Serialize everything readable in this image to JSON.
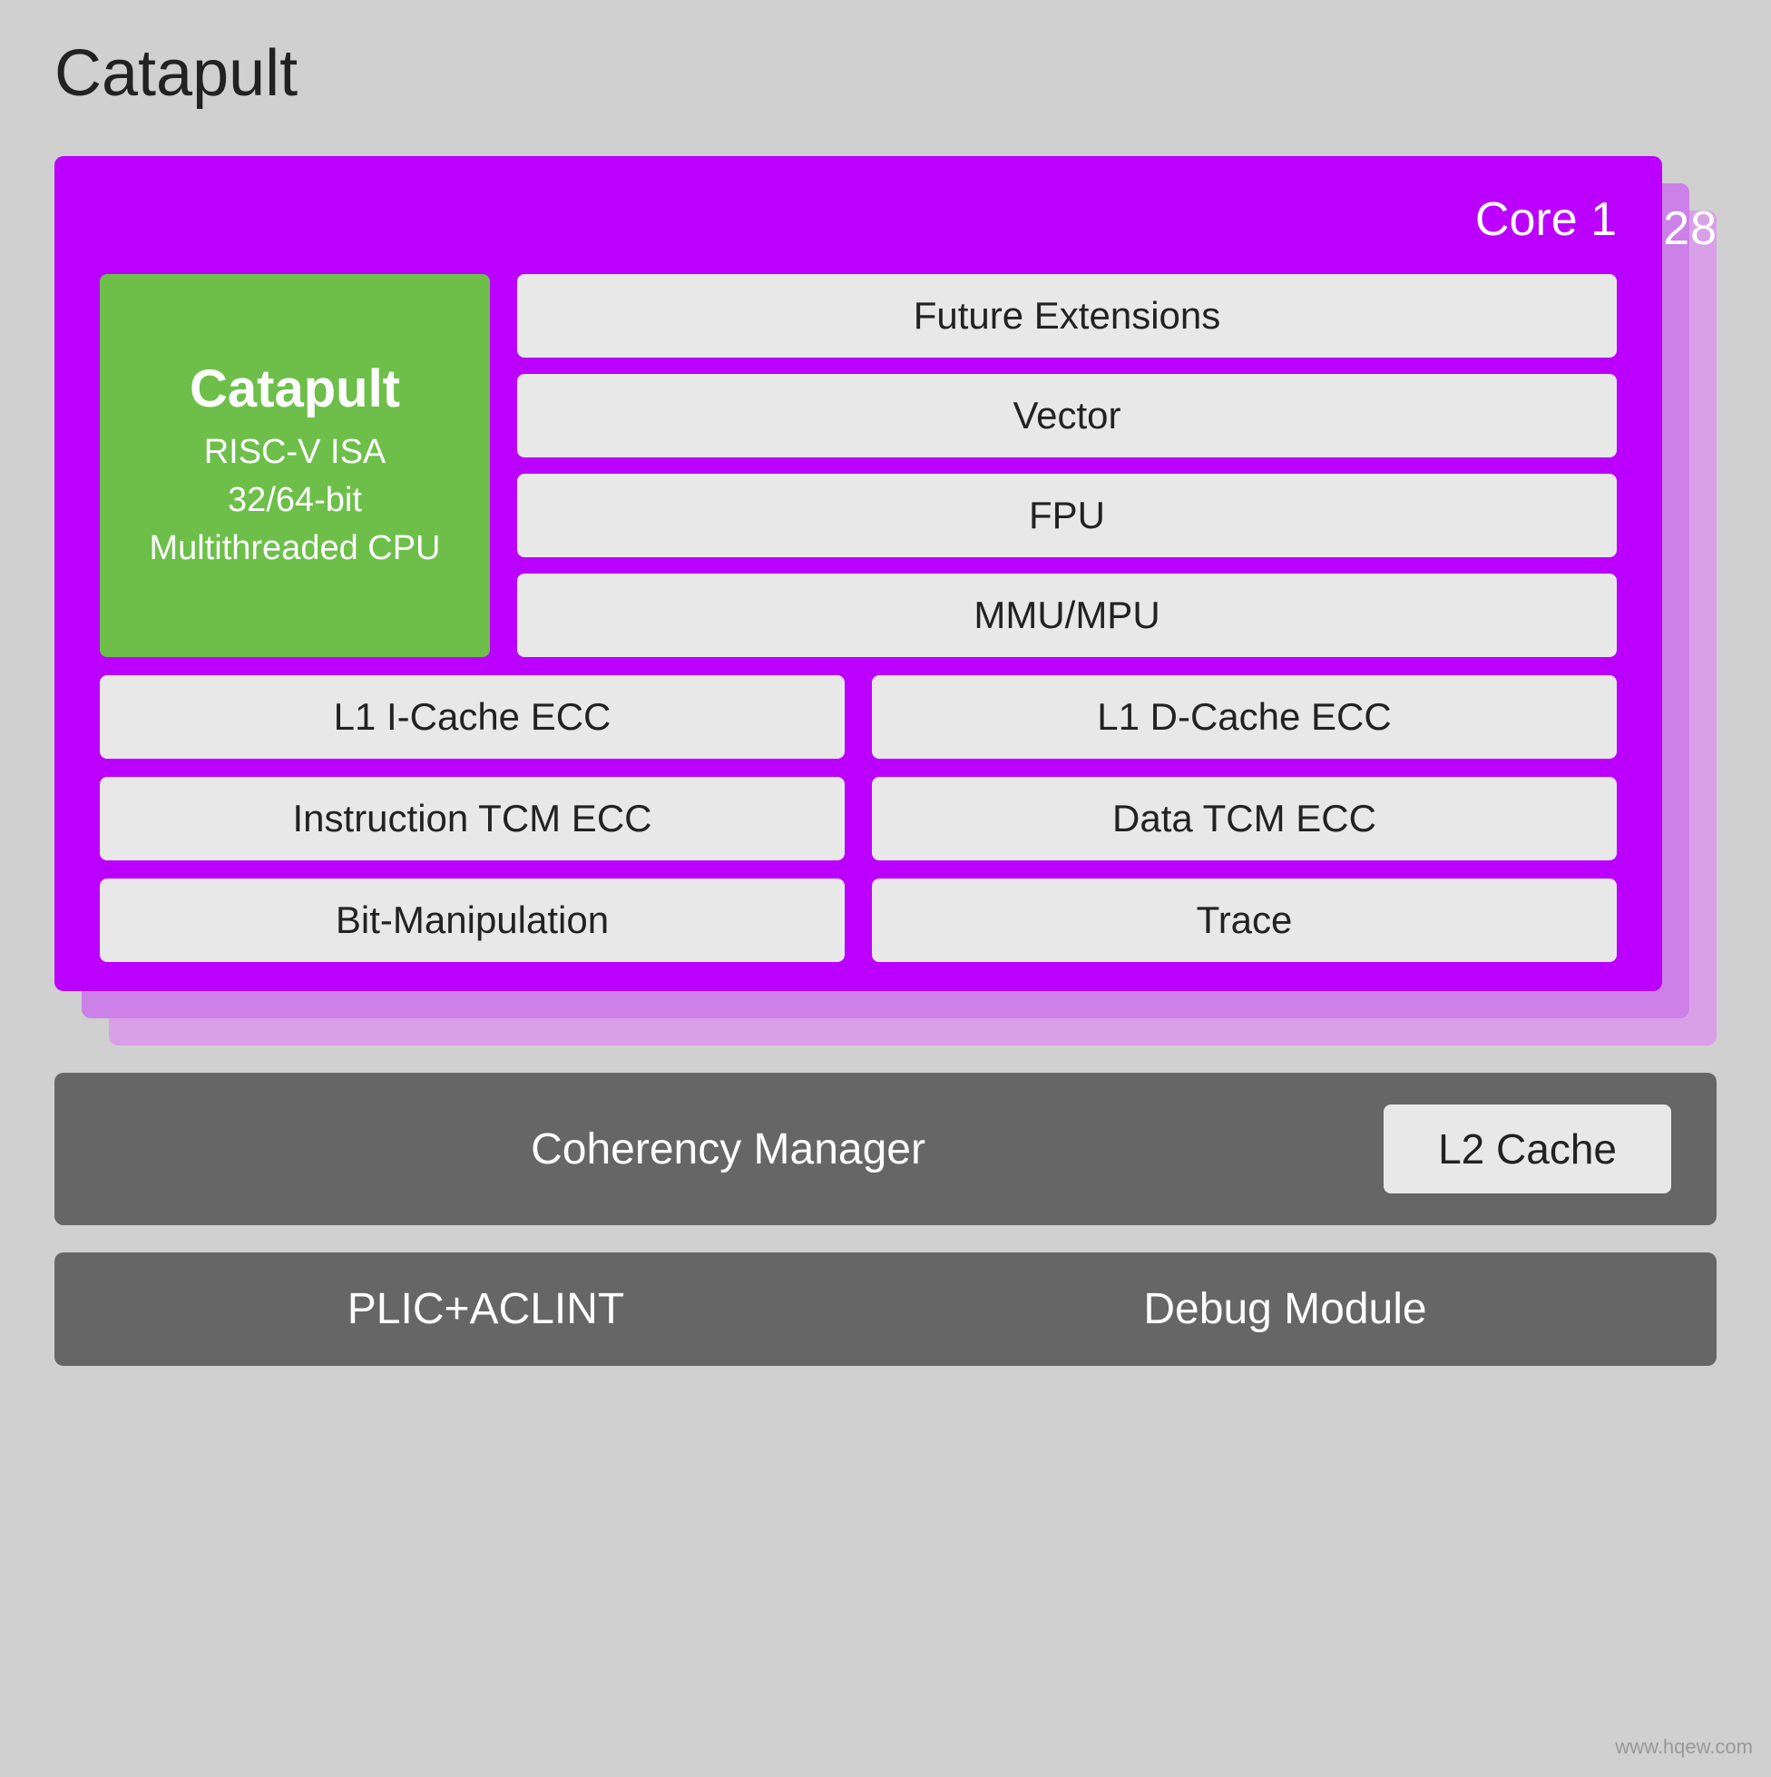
{
  "title": "Catapult",
  "cores": {
    "core1_label": "Core 1",
    "core2_label": "2",
    "core8_label": "8"
  },
  "catapult_box": {
    "title": "Catapult",
    "subtitle": "RISC-V ISA\n32/64-bit\nMultithreaded CPU"
  },
  "modules_right": [
    "Future Extensions",
    "Vector",
    "FPU",
    "MMU/MPU"
  ],
  "bottom_modules": [
    {
      "left": "L1 I-Cache ECC",
      "right": "L1 D-Cache ECC"
    },
    {
      "left": "Instruction TCM ECC",
      "right": "Data TCM ECC"
    },
    {
      "left": "Bit-Manipulation",
      "right": "Trace"
    }
  ],
  "coherency": {
    "label": "Coherency Manager",
    "l2": "L2 Cache"
  },
  "bottom_bar": {
    "plic": "PLIC+ACLINT",
    "debug": "Debug Module"
  },
  "watermark": "www.hqew.com"
}
